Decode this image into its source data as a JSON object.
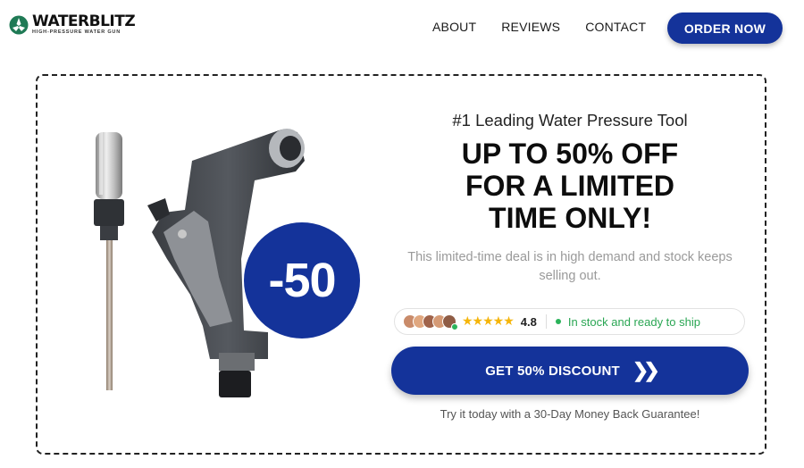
{
  "brand": {
    "name": "WATERBLITZ",
    "tagline": "HIGH-PRESSURE WATER GUN",
    "logo_icon": "leaf-droplet-icon",
    "accent_color": "#14339a"
  },
  "nav": {
    "items": [
      {
        "label": "ABOUT"
      },
      {
        "label": "REVIEWS"
      },
      {
        "label": "CONTACT"
      }
    ],
    "order_label": "ORDER NOW"
  },
  "hero": {
    "discount_badge": "-50",
    "eyebrow": "#1 Leading Water Pressure Tool",
    "headline_line1": "UP TO 50% OFF",
    "headline_line2": "FOR A LIMITED",
    "headline_line3": "TIME ONLY!",
    "subtext": "This limited-time deal is in high demand and stock keeps selling out.",
    "rating": "4.8",
    "stars_icon": "star-rating-icon",
    "stock_status": "In stock and ready to ship",
    "cta_label": "GET 50% DISCOUNT",
    "cta_icon": "double-chevron-right-icon",
    "guarantee": "Try it today with a 30-Day Money Back Guarantee!",
    "status_color": "#2bb35a"
  }
}
